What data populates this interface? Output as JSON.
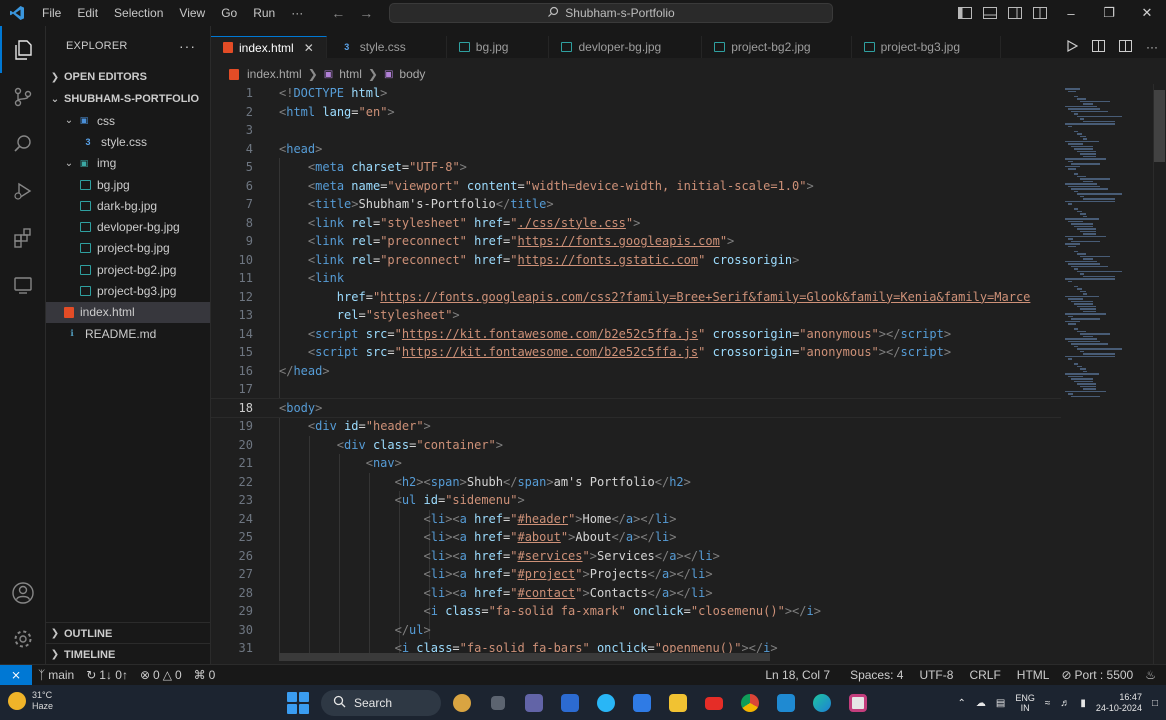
{
  "titlebar": {
    "menu": [
      "File",
      "Edit",
      "Selection",
      "View",
      "Go",
      "Run",
      "···"
    ],
    "search_text": "Shubham-s-Portfolio"
  },
  "sidebar": {
    "title": "EXPLORER",
    "open_editors": "OPEN EDITORS",
    "project": "SHUBHAM-S-PORTFOLIO",
    "tree": [
      {
        "label": "css",
        "type": "folder",
        "depth": 1,
        "open": true
      },
      {
        "label": "style.css",
        "type": "css",
        "depth": 2
      },
      {
        "label": "img",
        "type": "folder",
        "depth": 1,
        "open": true
      },
      {
        "label": "bg.jpg",
        "type": "image",
        "depth": 2
      },
      {
        "label": "dark-bg.jpg",
        "type": "image",
        "depth": 2
      },
      {
        "label": "devloper-bg.jpg",
        "type": "image",
        "depth": 2
      },
      {
        "label": "project-bg.jpg",
        "type": "image",
        "depth": 2
      },
      {
        "label": "project-bg2.jpg",
        "type": "image",
        "depth": 2
      },
      {
        "label": "project-bg3.jpg",
        "type": "image",
        "depth": 2
      },
      {
        "label": "index.html",
        "type": "html",
        "depth": 1,
        "selected": true
      },
      {
        "label": "README.md",
        "type": "md",
        "depth": 1
      }
    ],
    "outline": "OUTLINE",
    "timeline": "TIMELINE"
  },
  "tabs": [
    {
      "label": "index.html",
      "icon": "html-icon",
      "active": true
    },
    {
      "label": "style.css",
      "icon": "css-icon"
    },
    {
      "label": "bg.jpg",
      "icon": "image-icon"
    },
    {
      "label": "devloper-bg.jpg",
      "icon": "image-icon"
    },
    {
      "label": "project-bg2.jpg",
      "icon": "image-icon"
    },
    {
      "label": "project-bg3.jpg",
      "icon": "image-icon"
    }
  ],
  "breadcrumb": [
    "index.html",
    "html",
    "body"
  ],
  "editor": {
    "current_line": 18,
    "lines": [
      [
        [
          "p",
          "<!"
        ],
        [
          "t",
          "DOCTYPE"
        ],
        [
          "tx",
          " "
        ],
        [
          "a",
          "html"
        ],
        [
          "p",
          ">"
        ]
      ],
      [
        [
          "p",
          "<"
        ],
        [
          "t",
          "html"
        ],
        [
          "tx",
          " "
        ],
        [
          "a",
          "lang"
        ],
        [
          "tx",
          "="
        ],
        [
          "s",
          "\"en\""
        ],
        [
          "p",
          ">"
        ]
      ],
      [],
      [
        [
          "p",
          "<"
        ],
        [
          "t",
          "head"
        ],
        [
          "p",
          ">"
        ]
      ],
      [
        [
          "tx",
          "    "
        ],
        [
          "p",
          "<"
        ],
        [
          "t",
          "meta"
        ],
        [
          "tx",
          " "
        ],
        [
          "a",
          "charset"
        ],
        [
          "tx",
          "="
        ],
        [
          "s",
          "\"UTF-8\""
        ],
        [
          "p",
          ">"
        ]
      ],
      [
        [
          "tx",
          "    "
        ],
        [
          "p",
          "<"
        ],
        [
          "t",
          "meta"
        ],
        [
          "tx",
          " "
        ],
        [
          "a",
          "name"
        ],
        [
          "tx",
          "="
        ],
        [
          "s",
          "\"viewport\""
        ],
        [
          "tx",
          " "
        ],
        [
          "a",
          "content"
        ],
        [
          "tx",
          "="
        ],
        [
          "s",
          "\"width=device-width, initial-scale=1.0\""
        ],
        [
          "p",
          ">"
        ]
      ],
      [
        [
          "tx",
          "    "
        ],
        [
          "p",
          "<"
        ],
        [
          "t",
          "title"
        ],
        [
          "p",
          ">"
        ],
        [
          "tx",
          "Shubham's-Portfolio"
        ],
        [
          "p",
          "</"
        ],
        [
          "t",
          "title"
        ],
        [
          "p",
          ">"
        ]
      ],
      [
        [
          "tx",
          "    "
        ],
        [
          "p",
          "<"
        ],
        [
          "t",
          "link"
        ],
        [
          "tx",
          " "
        ],
        [
          "a",
          "rel"
        ],
        [
          "tx",
          "="
        ],
        [
          "s",
          "\"stylesheet\""
        ],
        [
          "tx",
          " "
        ],
        [
          "a",
          "href"
        ],
        [
          "tx",
          "="
        ],
        [
          "s",
          "\""
        ],
        [
          "u",
          "./css/style.css"
        ],
        [
          "s",
          "\""
        ],
        [
          "p",
          ">"
        ]
      ],
      [
        [
          "tx",
          "    "
        ],
        [
          "p",
          "<"
        ],
        [
          "t",
          "link"
        ],
        [
          "tx",
          " "
        ],
        [
          "a",
          "rel"
        ],
        [
          "tx",
          "="
        ],
        [
          "s",
          "\"preconnect\""
        ],
        [
          "tx",
          " "
        ],
        [
          "a",
          "href"
        ],
        [
          "tx",
          "="
        ],
        [
          "s",
          "\""
        ],
        [
          "u",
          "https://fonts.googleapis.com"
        ],
        [
          "s",
          "\""
        ],
        [
          "p",
          ">"
        ]
      ],
      [
        [
          "tx",
          "    "
        ],
        [
          "p",
          "<"
        ],
        [
          "t",
          "link"
        ],
        [
          "tx",
          " "
        ],
        [
          "a",
          "rel"
        ],
        [
          "tx",
          "="
        ],
        [
          "s",
          "\"preconnect\""
        ],
        [
          "tx",
          " "
        ],
        [
          "a",
          "href"
        ],
        [
          "tx",
          "="
        ],
        [
          "s",
          "\""
        ],
        [
          "u",
          "https://fonts.gstatic.com"
        ],
        [
          "s",
          "\""
        ],
        [
          "tx",
          " "
        ],
        [
          "a",
          "crossorigin"
        ],
        [
          "p",
          ">"
        ]
      ],
      [
        [
          "tx",
          "    "
        ],
        [
          "p",
          "<"
        ],
        [
          "t",
          "link"
        ]
      ],
      [
        [
          "tx",
          "        "
        ],
        [
          "a",
          "href"
        ],
        [
          "tx",
          "="
        ],
        [
          "s",
          "\""
        ],
        [
          "u",
          "https://fonts.googleapis.com/css2?family=Bree+Serif&family=Glook&family=Kenia&family=Marce"
        ]
      ],
      [
        [
          "tx",
          "        "
        ],
        [
          "a",
          "rel"
        ],
        [
          "tx",
          "="
        ],
        [
          "s",
          "\"stylesheet\""
        ],
        [
          "p",
          ">"
        ]
      ],
      [
        [
          "tx",
          "    "
        ],
        [
          "p",
          "<"
        ],
        [
          "t",
          "script"
        ],
        [
          "tx",
          " "
        ],
        [
          "a",
          "src"
        ],
        [
          "tx",
          "="
        ],
        [
          "s",
          "\""
        ],
        [
          "u",
          "https://kit.fontawesome.com/b2e52c5ffa.js"
        ],
        [
          "s",
          "\""
        ],
        [
          "tx",
          " "
        ],
        [
          "a",
          "crossorigin"
        ],
        [
          "tx",
          "="
        ],
        [
          "s",
          "\"anonymous\""
        ],
        [
          "p",
          "></"
        ],
        [
          "t",
          "script"
        ],
        [
          "p",
          ">"
        ]
      ],
      [
        [
          "tx",
          "    "
        ],
        [
          "p",
          "<"
        ],
        [
          "t",
          "script"
        ],
        [
          "tx",
          " "
        ],
        [
          "a",
          "src"
        ],
        [
          "tx",
          "="
        ],
        [
          "s",
          "\""
        ],
        [
          "u",
          "https://kit.fontawesome.com/b2e52c5ffa.js"
        ],
        [
          "s",
          "\""
        ],
        [
          "tx",
          " "
        ],
        [
          "a",
          "crossorigin"
        ],
        [
          "tx",
          "="
        ],
        [
          "s",
          "\"anonymous\""
        ],
        [
          "p",
          "></"
        ],
        [
          "t",
          "script"
        ],
        [
          "p",
          ">"
        ]
      ],
      [
        [
          "p",
          "</"
        ],
        [
          "t",
          "head"
        ],
        [
          "p",
          ">"
        ]
      ],
      [],
      [
        [
          "p",
          "<"
        ],
        [
          "t",
          "body"
        ],
        [
          "p",
          ">"
        ]
      ],
      [
        [
          "tx",
          "    "
        ],
        [
          "p",
          "<"
        ],
        [
          "t",
          "div"
        ],
        [
          "tx",
          " "
        ],
        [
          "a",
          "id"
        ],
        [
          "tx",
          "="
        ],
        [
          "s",
          "\"header\""
        ],
        [
          "p",
          ">"
        ]
      ],
      [
        [
          "tx",
          "        "
        ],
        [
          "p",
          "<"
        ],
        [
          "t",
          "div"
        ],
        [
          "tx",
          " "
        ],
        [
          "a",
          "class"
        ],
        [
          "tx",
          "="
        ],
        [
          "s",
          "\"container\""
        ],
        [
          "p",
          ">"
        ]
      ],
      [
        [
          "tx",
          "            "
        ],
        [
          "p",
          "<"
        ],
        [
          "t",
          "nav"
        ],
        [
          "p",
          ">"
        ]
      ],
      [
        [
          "tx",
          "                "
        ],
        [
          "p",
          "<"
        ],
        [
          "t",
          "h2"
        ],
        [
          "p",
          "><"
        ],
        [
          "t",
          "span"
        ],
        [
          "p",
          ">"
        ],
        [
          "tx",
          "Shubh"
        ],
        [
          "p",
          "</"
        ],
        [
          "t",
          "span"
        ],
        [
          "p",
          ">"
        ],
        [
          "tx",
          "am's Portfolio"
        ],
        [
          "p",
          "</"
        ],
        [
          "t",
          "h2"
        ],
        [
          "p",
          ">"
        ]
      ],
      [
        [
          "tx",
          "                "
        ],
        [
          "p",
          "<"
        ],
        [
          "t",
          "ul"
        ],
        [
          "tx",
          " "
        ],
        [
          "a",
          "id"
        ],
        [
          "tx",
          "="
        ],
        [
          "s",
          "\"sidemenu\""
        ],
        [
          "p",
          ">"
        ]
      ],
      [
        [
          "tx",
          "                    "
        ],
        [
          "p",
          "<"
        ],
        [
          "t",
          "li"
        ],
        [
          "p",
          "><"
        ],
        [
          "t",
          "a"
        ],
        [
          "tx",
          " "
        ],
        [
          "a",
          "href"
        ],
        [
          "tx",
          "="
        ],
        [
          "s",
          "\""
        ],
        [
          "u",
          "#header"
        ],
        [
          "s",
          "\""
        ],
        [
          "p",
          ">"
        ],
        [
          "tx",
          "Home"
        ],
        [
          "p",
          "</"
        ],
        [
          "t",
          "a"
        ],
        [
          "p",
          "></"
        ],
        [
          "t",
          "li"
        ],
        [
          "p",
          ">"
        ]
      ],
      [
        [
          "tx",
          "                    "
        ],
        [
          "p",
          "<"
        ],
        [
          "t",
          "li"
        ],
        [
          "p",
          "><"
        ],
        [
          "t",
          "a"
        ],
        [
          "tx",
          " "
        ],
        [
          "a",
          "href"
        ],
        [
          "tx",
          "="
        ],
        [
          "s",
          "\""
        ],
        [
          "u",
          "#about"
        ],
        [
          "s",
          "\""
        ],
        [
          "p",
          ">"
        ],
        [
          "tx",
          "About"
        ],
        [
          "p",
          "</"
        ],
        [
          "t",
          "a"
        ],
        [
          "p",
          "></"
        ],
        [
          "t",
          "li"
        ],
        [
          "p",
          ">"
        ]
      ],
      [
        [
          "tx",
          "                    "
        ],
        [
          "p",
          "<"
        ],
        [
          "t",
          "li"
        ],
        [
          "p",
          "><"
        ],
        [
          "t",
          "a"
        ],
        [
          "tx",
          " "
        ],
        [
          "a",
          "href"
        ],
        [
          "tx",
          "="
        ],
        [
          "s",
          "\""
        ],
        [
          "u",
          "#services"
        ],
        [
          "s",
          "\""
        ],
        [
          "p",
          ">"
        ],
        [
          "tx",
          "Services"
        ],
        [
          "p",
          "</"
        ],
        [
          "t",
          "a"
        ],
        [
          "p",
          "></"
        ],
        [
          "t",
          "li"
        ],
        [
          "p",
          ">"
        ]
      ],
      [
        [
          "tx",
          "                    "
        ],
        [
          "p",
          "<"
        ],
        [
          "t",
          "li"
        ],
        [
          "p",
          "><"
        ],
        [
          "t",
          "a"
        ],
        [
          "tx",
          " "
        ],
        [
          "a",
          "href"
        ],
        [
          "tx",
          "="
        ],
        [
          "s",
          "\""
        ],
        [
          "u",
          "#project"
        ],
        [
          "s",
          "\""
        ],
        [
          "p",
          ">"
        ],
        [
          "tx",
          "Projects"
        ],
        [
          "p",
          "</"
        ],
        [
          "t",
          "a"
        ],
        [
          "p",
          "></"
        ],
        [
          "t",
          "li"
        ],
        [
          "p",
          ">"
        ]
      ],
      [
        [
          "tx",
          "                    "
        ],
        [
          "p",
          "<"
        ],
        [
          "t",
          "li"
        ],
        [
          "p",
          "><"
        ],
        [
          "t",
          "a"
        ],
        [
          "tx",
          " "
        ],
        [
          "a",
          "href"
        ],
        [
          "tx",
          "="
        ],
        [
          "s",
          "\""
        ],
        [
          "u",
          "#contact"
        ],
        [
          "s",
          "\""
        ],
        [
          "p",
          ">"
        ],
        [
          "tx",
          "Contacts"
        ],
        [
          "p",
          "</"
        ],
        [
          "t",
          "a"
        ],
        [
          "p",
          "></"
        ],
        [
          "t",
          "li"
        ],
        [
          "p",
          ">"
        ]
      ],
      [
        [
          "tx",
          "                    "
        ],
        [
          "p",
          "<"
        ],
        [
          "t",
          "i"
        ],
        [
          "tx",
          " "
        ],
        [
          "a",
          "class"
        ],
        [
          "tx",
          "="
        ],
        [
          "s",
          "\"fa-solid fa-xmark\""
        ],
        [
          "tx",
          " "
        ],
        [
          "a",
          "onclick"
        ],
        [
          "tx",
          "="
        ],
        [
          "s",
          "\"closemenu()\""
        ],
        [
          "p",
          "></"
        ],
        [
          "t",
          "i"
        ],
        [
          "p",
          ">"
        ]
      ],
      [
        [
          "tx",
          "                "
        ],
        [
          "p",
          "</"
        ],
        [
          "t",
          "ul"
        ],
        [
          "p",
          ">"
        ]
      ],
      [
        [
          "tx",
          "                "
        ],
        [
          "p",
          "<"
        ],
        [
          "t",
          "i"
        ],
        [
          "tx",
          " "
        ],
        [
          "a",
          "class"
        ],
        [
          "tx",
          "="
        ],
        [
          "s",
          "\"fa-solid fa-bars\""
        ],
        [
          "tx",
          " "
        ],
        [
          "a",
          "onclick"
        ],
        [
          "tx",
          "="
        ],
        [
          "s",
          "\"openmenu()\""
        ],
        [
          "p",
          "></"
        ],
        [
          "t",
          "i"
        ],
        [
          "p",
          ">"
        ]
      ]
    ]
  },
  "status": {
    "branch": "main",
    "sync": "1↓ 0↑",
    "errors": "0",
    "warnings": "0",
    "ports": "0",
    "position": "Ln 18, Col 7",
    "spaces": "Spaces: 4",
    "encoding": "UTF-8",
    "eol": "CRLF",
    "language": "HTML",
    "port": "Port : 5500"
  },
  "taskbar": {
    "temp": "31°C",
    "weather": "Haze",
    "search": "Search",
    "lang1": "ENG",
    "lang2": "IN",
    "time": "16:47",
    "date": "24-10-2024"
  }
}
